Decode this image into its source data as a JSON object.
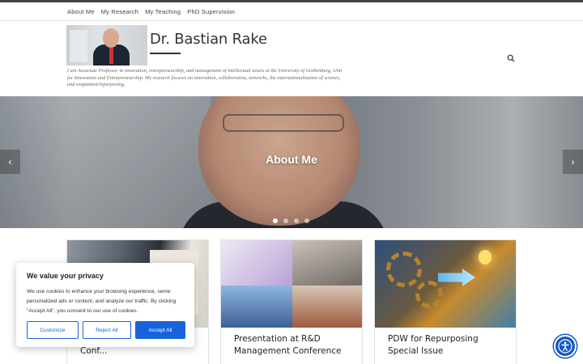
{
  "nav": {
    "items": [
      "About Me",
      "My Research",
      "My Teaching",
      "PhD Supervision"
    ]
  },
  "header": {
    "site_title": "Dr. Bastian Rake",
    "tagline": "I am Associate Professor in innovation, entrepreneurship, and management of intellectual assets at the University of Gothenburg, Unit for Innovation and Entrepreneurship. My research focuses on innovation, collaboration, networks, the internationalization of science, and exaptation/repurposing."
  },
  "hero": {
    "title": "About Me",
    "slides_total": 4,
    "active_slide": 1,
    "prev_icon": "chevron-left-icon",
    "next_icon": "chevron-right-icon"
  },
  "cards": [
    {
      "title": "Schumpeter Society Conf..."
    },
    {
      "title": "Presentation at R&D Management Conference"
    },
    {
      "title": "PDW for Repurposing Special Issue"
    }
  ],
  "cookie": {
    "heading": "We value your privacy",
    "body": "We use cookies to enhance your browsing experience, serve personalized ads or content, and analyze our traffic. By clicking \"Accept All\", you consent to our use of cookies.",
    "customize": "Customize",
    "reject": "Reject All",
    "accept": "Accept All"
  },
  "colors": {
    "accent": "#1863dc",
    "accessibility": "#1459c7"
  }
}
